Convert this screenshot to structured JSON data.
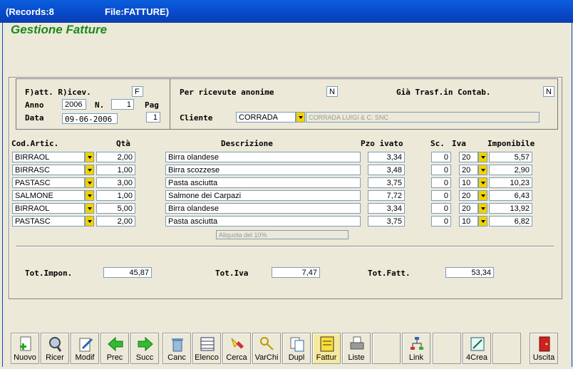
{
  "window": {
    "records": "(Records:8",
    "file": "File:FATTURE)"
  },
  "app": {
    "title": "Gestione Fatture"
  },
  "header": {
    "fatt_label": "F)att. R)icev.",
    "fatt_value": "F",
    "anno_label": "Anno",
    "anno_value": "2006",
    "n_label": "N.",
    "n_value": "1",
    "pag_label": "Pag",
    "pag_value": "1",
    "data_label": "Data",
    "data_value": "09-06-2006",
    "anonime_label": "Per ricevute anonime",
    "anonime_value": "N",
    "trasf_label": "Già Trasf.in Contab.",
    "trasf_value": "N",
    "cliente_label": "Cliente",
    "cliente_value": "CORRADA",
    "cliente_desc": "CORRADA LUIGI & C. SNC"
  },
  "columns": {
    "cod": "Cod.Artic.",
    "qta": "Qtà",
    "descr": "Descrizione",
    "pzo": "Pzo ivato",
    "sc": "Sc.",
    "iva": "Iva",
    "impon": "Imponibile"
  },
  "rows": [
    {
      "cod": "BIRRAOL",
      "qta": "2,00",
      "descr": "Birra olandese",
      "pzo": "3,34",
      "sc": "0",
      "iva": "20",
      "impon": "5,57"
    },
    {
      "cod": "BIRRASC",
      "qta": "1,00",
      "descr": "Birra scozzese",
      "pzo": "3,48",
      "sc": "0",
      "iva": "20",
      "impon": "2,90"
    },
    {
      "cod": "PASTASC",
      "qta": "3,00",
      "descr": "Pasta asciutta",
      "pzo": "3,75",
      "sc": "0",
      "iva": "10",
      "impon": "10,23"
    },
    {
      "cod": "SALMONE",
      "qta": "1,00",
      "descr": "Salmone dei Carpazi",
      "pzo": "7,72",
      "sc": "0",
      "iva": "20",
      "impon": "6,43"
    },
    {
      "cod": "BIRRAOL",
      "qta": "5,00",
      "descr": "Birra olandese",
      "pzo": "3,34",
      "sc": "0",
      "iva": "20",
      "impon": "13,92"
    },
    {
      "cod": "PASTASC",
      "qta": "2,00",
      "descr": "Pasta asciutta",
      "pzo": "3,75",
      "sc": "0",
      "iva": "10",
      "impon": "6,82"
    }
  ],
  "aliquota_hint": "Aliquota del 10%",
  "totals": {
    "impon_label": "Tot.Impon.",
    "impon_value": "45,87",
    "iva_label": "Tot.Iva",
    "iva_value": "7,47",
    "fatt_label": "Tot.Fatt.",
    "fatt_value": "53,34"
  },
  "toolbar": {
    "nuovo": "Nuovo",
    "ricer": "Ricer",
    "modif": "Modif",
    "prec": "Prec",
    "succ": "Succ",
    "canc": "Canc",
    "elenco": "Elenco",
    "cerca": "Cerca",
    "varchi": "VarChi",
    "dupl": "Dupl",
    "fattur": "Fattur",
    "liste": "Liste",
    "link": "Link",
    "crea4": "4Crea",
    "uscita": "Uscita"
  },
  "icons": {
    "nuovo": "new-document-icon",
    "ricer": "magnifier-icon",
    "modif": "edit-document-icon",
    "prec": "arrow-left-icon",
    "succ": "arrow-right-icon",
    "canc": "trash-icon",
    "elenco": "list-icon",
    "cerca": "search-flashlight-icon",
    "varchi": "keys-icon",
    "dupl": "duplicate-icon",
    "fattur": "invoice-icon",
    "liste": "printer-icon",
    "link": "link-tree-icon",
    "crea4": "create-icon",
    "uscita": "exit-door-icon"
  },
  "colors": {
    "title_green": "#1a8a1a",
    "titlebar_blue": "#0848c8",
    "dropdown_yellow": "#f2d200"
  }
}
